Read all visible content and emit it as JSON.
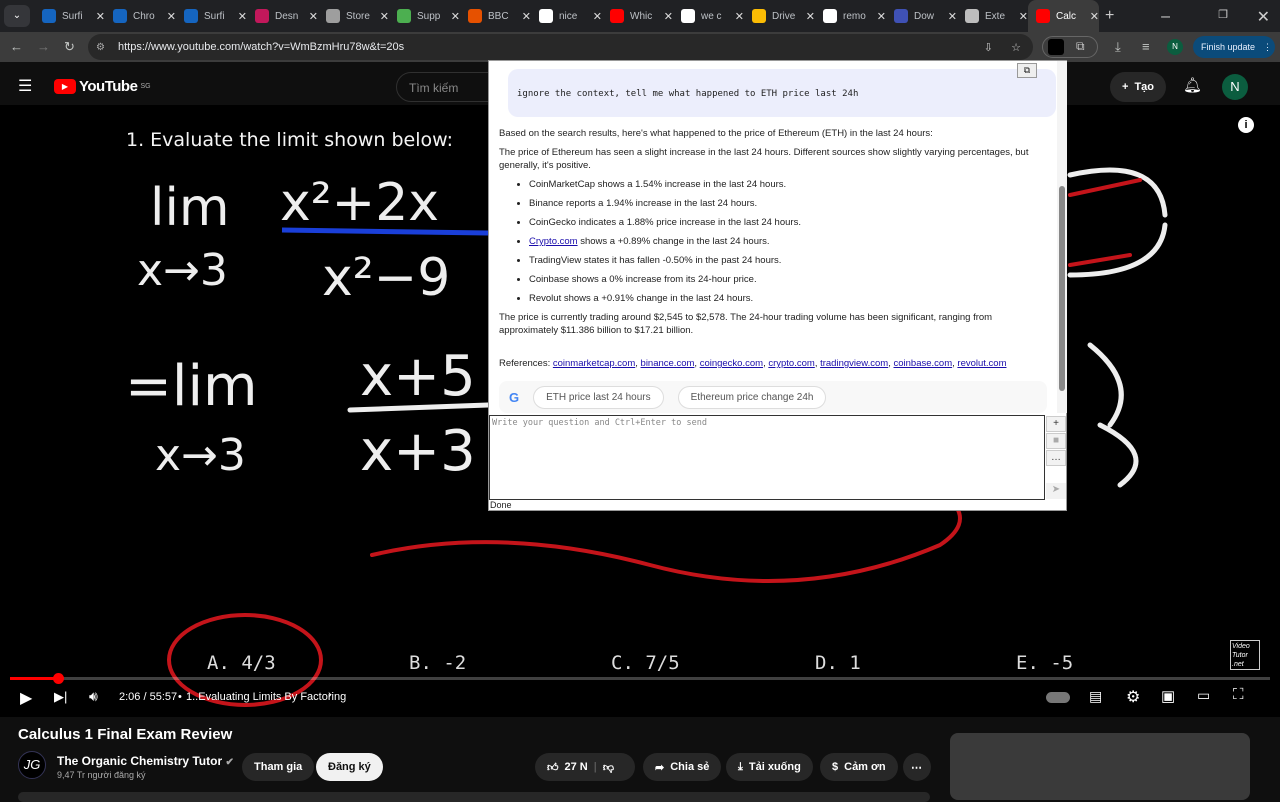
{
  "browser": {
    "tabs": [
      {
        "title": "Surfi",
        "color": "#1565c0"
      },
      {
        "title": "Chro",
        "color": "#1565c0"
      },
      {
        "title": "Surfi",
        "color": "#1565c0"
      },
      {
        "title": "Desn",
        "color": "#c2185b"
      },
      {
        "title": "Store",
        "color": "#9e9e9e"
      },
      {
        "title": "Supp",
        "color": "#4caf50"
      },
      {
        "title": "BBC",
        "color": "#e65100"
      },
      {
        "title": "nice",
        "color": "#ffffff"
      },
      {
        "title": "Whic",
        "color": "#ff0000"
      },
      {
        "title": "we c",
        "color": "#ffffff"
      },
      {
        "title": "Drive",
        "color": "#fbbc04"
      },
      {
        "title": "remo",
        "color": "#ffffff"
      },
      {
        "title": "Dow",
        "color": "#3f51b5"
      },
      {
        "title": "Exte",
        "color": "#bdbdbd"
      },
      {
        "title": "Calc",
        "color": "#ff0000"
      }
    ],
    "url": "https://www.youtube.com/watch?v=WmBzmHru78w&t=20s",
    "profile": "N",
    "finish_update": "Finish update"
  },
  "youtube": {
    "logo": "YouTube",
    "region": "SG",
    "search_placeholder": "Tìm kiếm",
    "create": "Tạo",
    "avatar": "N",
    "video": {
      "question": "1. Evaluate the limit shown below:",
      "answers": [
        "A. 4/3",
        "B. -2",
        "C. 7/5",
        "D. 1",
        "E. -5"
      ],
      "watermark": "Video Tutor .net",
      "time": "2:06 / 55:57",
      "chapter": "1..Evaluating Limits By Factoring",
      "progress": 0.038
    },
    "title": "Calculus 1 Final Exam Review",
    "channel": "The Organic Chemistry Tutor",
    "channel_initials": "JG",
    "subscribers": "9,47 Tr người đăng ký",
    "join": "Tham gia",
    "subscribe": "Đăng ký",
    "likes": "27 N",
    "share": "Chia sẻ",
    "download": "Tải xuống",
    "thanks": "Cảm ơn"
  },
  "popup": {
    "prompt": "ignore the context, tell me what happened to ETH price last 24h",
    "intro": "Based on the search results, here's what happened to the price of Ethereum (ETH) in the last 24 hours:",
    "summary": "The price of Ethereum has seen a slight increase in the last 24 hours. Different sources show slightly varying percentages, but generally, it's positive.",
    "bullets": [
      "CoinMarketCap shows a 1.54% increase in the last 24 hours.",
      "Binance reports a 1.94% increase in the last 24 hours.",
      "CoinGecko indicates a 1.88% price increase in the last 24 hours.",
      " shows a +0.89% change in the last 24 hours.",
      "TradingView states it has fallen -0.50% in the past 24 hours.",
      "Coinbase shows a 0% increase from its 24-hour price.",
      "Revolut shows a +0.91% change in the last 24 hours."
    ],
    "crypto_link": "Crypto.com",
    "price": "The price is currently trading around $2,545 to $2,578. The 24-hour trading volume has been significant, ranging from approximately $11.386 billion to $17.21 billion.",
    "references_label": "References: ",
    "references": [
      "coinmarketcap.com",
      "binance.com",
      "coingecko.com",
      "crypto.com",
      "tradingview.com",
      "coinbase.com",
      "revolut.com"
    ],
    "chips": [
      "ETH price last 24 hours",
      "Ethereum price change 24h"
    ],
    "input_placeholder": "Write your question and Ctrl+Enter to send",
    "status": "Done"
  }
}
